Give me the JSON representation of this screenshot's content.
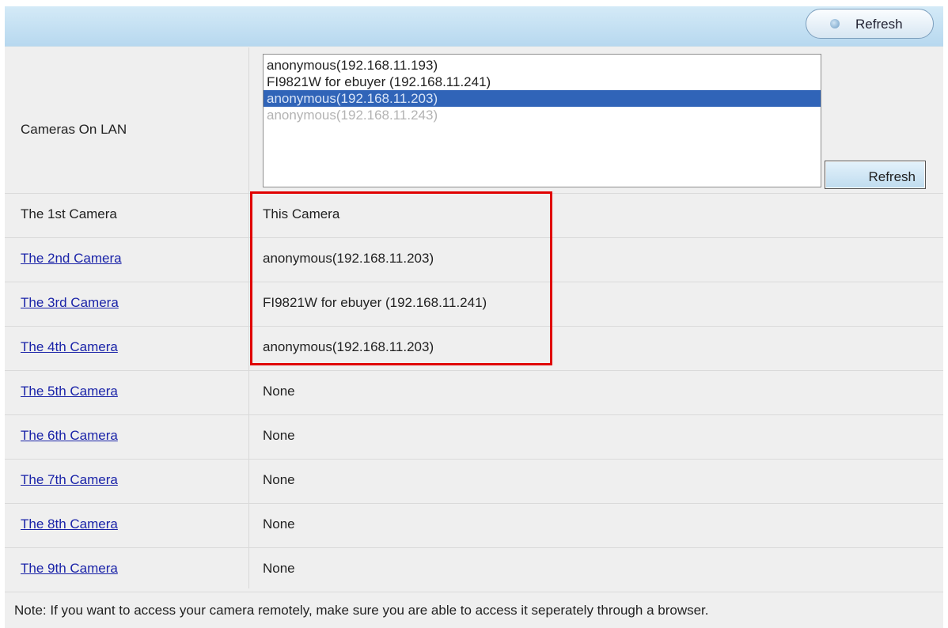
{
  "toolbar": {
    "refresh_label": "Refresh"
  },
  "lan": {
    "label": "Cameras On LAN",
    "options": [
      {
        "text": "anonymous(192.168.11.193)",
        "state": "normal"
      },
      {
        "text": "FI9821W for ebuyer (192.168.11.241)",
        "state": "normal"
      },
      {
        "text": "anonymous(192.168.11.203)",
        "state": "selected"
      },
      {
        "text": "anonymous(192.168.11.243)",
        "state": "dim"
      }
    ],
    "refresh_label": "Refresh"
  },
  "cameras": [
    {
      "label": "The 1st Camera",
      "value": "This Camera"
    },
    {
      "label": "The 2nd Camera",
      "value": "anonymous(192.168.11.203)"
    },
    {
      "label": "The 3rd Camera",
      "value": "FI9821W for ebuyer (192.168.11.241)"
    },
    {
      "label": "The 4th Camera",
      "value": "anonymous(192.168.11.203)"
    },
    {
      "label": "The 5th Camera",
      "value": "None"
    },
    {
      "label": "The 6th Camera",
      "value": "None"
    },
    {
      "label": "The 7th Camera",
      "value": "None"
    },
    {
      "label": "The 8th Camera",
      "value": "None"
    },
    {
      "label": "The 9th Camera",
      "value": "None"
    }
  ],
  "note": "Note: If you want to access your camera remotely, make sure you are able to access it seperately through a browser.",
  "colors": {
    "topbar": "#b7d8ef",
    "selection": "#3064b8",
    "link": "#1a23a8",
    "highlight_border": "#e00000"
  }
}
